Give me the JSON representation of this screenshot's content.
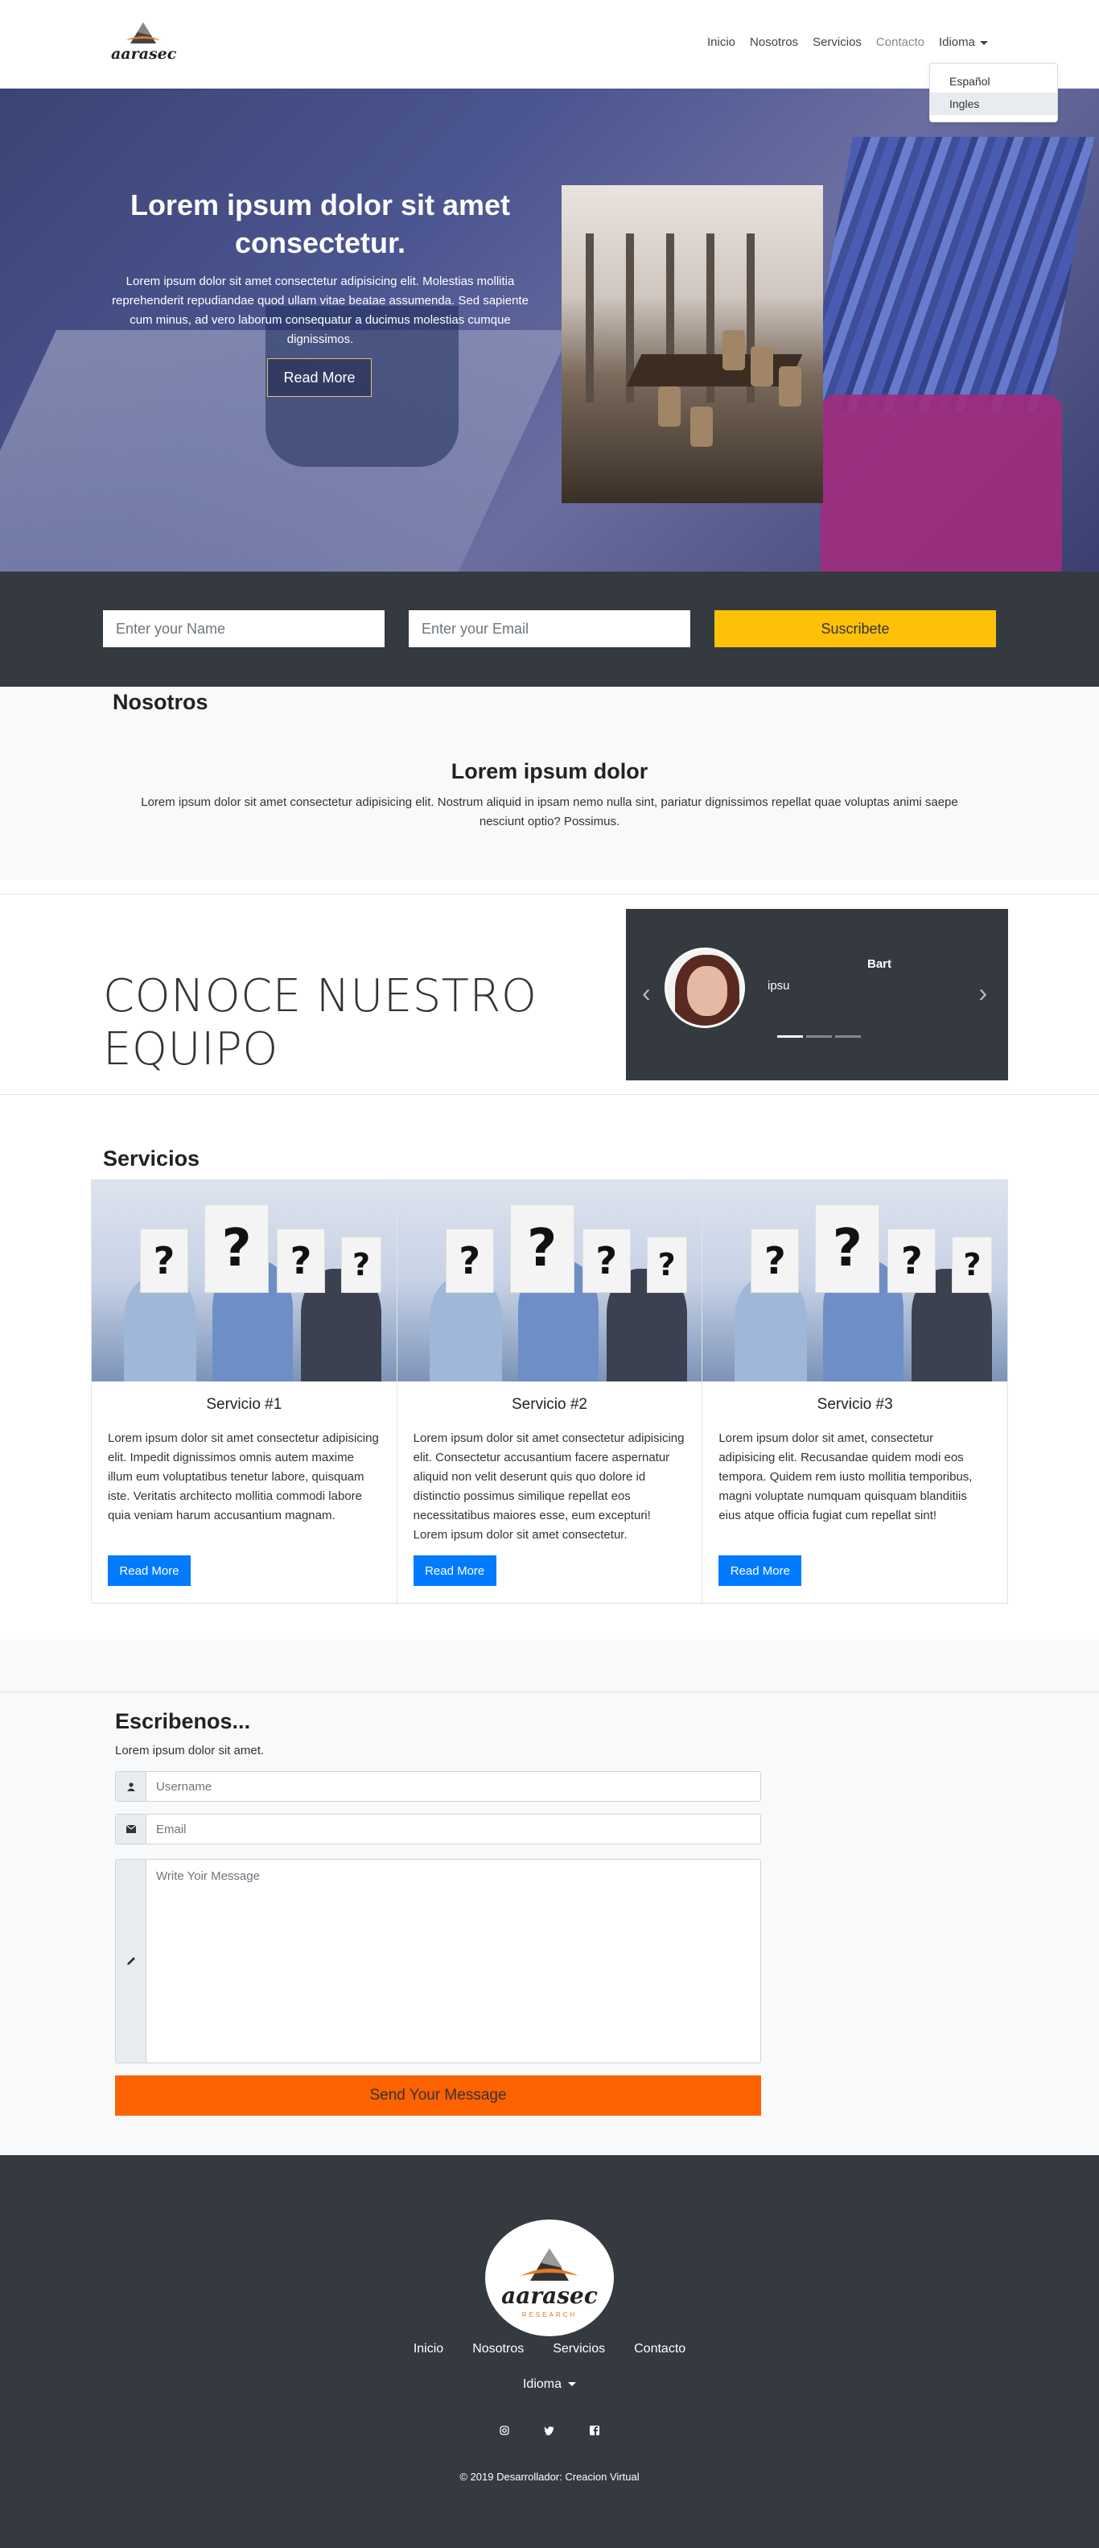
{
  "brand": {
    "name": "aarasec",
    "tagline": "RESEARCH"
  },
  "nav": {
    "links": [
      "Inicio",
      "Nosotros",
      "Servicios",
      "Contacto"
    ],
    "dropdown_label": "Idioma",
    "dropdown_items": [
      "Español",
      "Ingles"
    ]
  },
  "hero": {
    "title": "Lorem ipsum dolor sit amet consectetur.",
    "text": "Lorem ipsum dolor sit amet consectetur adipisicing elit. Molestias mollitia reprehenderit repudiandae quod ullam vitae beatae assumenda. Sed sapiente cum minus, ad vero laborum consequatur a ducimus molestias cumque dignissimos.",
    "button": "Read More"
  },
  "subscribe": {
    "name_placeholder": "Enter your Name",
    "email_placeholder": "Enter your Email",
    "button": "Suscribete"
  },
  "about": {
    "label": "Nosotros",
    "heading": "Lorem ipsum dolor",
    "text": "Lorem ipsum dolor sit amet consectetur adipisicing elit. Nostrum aliquid in ipsam nemo nulla sint, pariatur dignissimos repellat quae voluptas animi saepe nesciunt optio? Possimus."
  },
  "team": {
    "title": "CONOCE NUESTRO EQUIPO",
    "member_name": "Bart",
    "member_text": "ipsu",
    "prev": "‹",
    "next": "›",
    "slides": 3,
    "active_slide": 1
  },
  "services": {
    "label": "Servicios",
    "cards": [
      {
        "title": "Servicio #1",
        "text": "Lorem ipsum dolor sit amet consectetur adipisicing elit. Impedit dignissimos omnis autem maxime illum eum voluptatibus tenetur labore, quisquam iste. Veritatis architecto mollitia commodi labore quia veniam harum accusantium magnam.",
        "button": "Read More"
      },
      {
        "title": "Servicio #2",
        "text": "Lorem ipsum dolor sit amet consectetur adipisicing elit. Consectetur accusantium facere aspernatur aliquid non velit deserunt quis quo dolore id distinctio possimus similique repellat eos necessitatibus maiores esse, eum excepturi! Lorem ipsum dolor sit amet consectetur.",
        "button": "Read More"
      },
      {
        "title": "Servicio #3",
        "text": "Lorem ipsum dolor sit amet, consectetur adipisicing elit. Recusandae quidem modi eos tempora. Quidem rem iusto mollitia temporibus, magni voluptate numquam quisquam blanditiis eius atque officia fugiat cum repellat sint!",
        "button": "Read More"
      }
    ]
  },
  "contact": {
    "title": "Escribenos...",
    "subtitle": "Lorem ipsum dolor sit amet.",
    "username_placeholder": "Username",
    "email_placeholder": "Email",
    "message_placeholder": "Write Yoir Message",
    "button": "Send Your Message"
  },
  "footer": {
    "links": [
      "Inicio",
      "Nosotros",
      "Servicios",
      "Contacto"
    ],
    "lang_label": "Idioma",
    "social": [
      "instagram-icon",
      "twitter-icon",
      "facebook-icon"
    ],
    "copyright": "© 2019 Desarrollador: Creacion Virtual"
  },
  "colors": {
    "dark": "#343a40",
    "accent_yellow": "#ffc107",
    "accent_orange": "#fd6200",
    "primary_blue": "#007bff",
    "light": "#f8f9fa"
  }
}
